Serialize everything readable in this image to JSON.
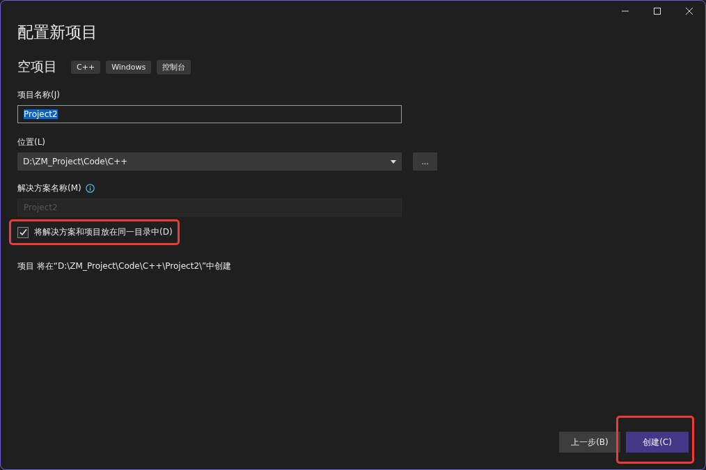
{
  "window": {
    "title": "配置新项目"
  },
  "template": {
    "name": "空项目",
    "tags": [
      "C++",
      "Windows",
      "控制台"
    ]
  },
  "project_name": {
    "label": "项目名称(J)",
    "value": "Project2",
    "selected": true
  },
  "location": {
    "label": "位置(L)",
    "value": "D:\\ZM_Project\\Code\\C++",
    "browse": "..."
  },
  "solution_name": {
    "label": "解决方案名称(M)",
    "placeholder": "Project2",
    "disabled": true
  },
  "same_directory": {
    "label": "将解决方案和项目放在同一目录中(D)",
    "checked": true,
    "highlighted": true
  },
  "info": "项目 将在“D:\\ZM_Project\\Code\\C++\\Project2\\”中创建",
  "buttons": [
    {
      "label": "上一步(B)",
      "kind": "secondary",
      "highlighted": false
    },
    {
      "label": "创建(C)",
      "kind": "primary",
      "highlighted": true
    }
  ]
}
